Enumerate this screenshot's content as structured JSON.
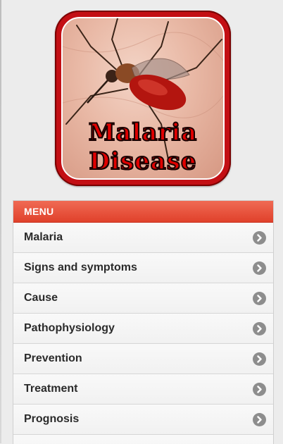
{
  "logo": {
    "line1": "Malaria",
    "line2": "Disease",
    "image_icon": "mosquito-icon",
    "frame_color": "#c30f14"
  },
  "menu": {
    "header": "MENU",
    "header_color": "#e94b35",
    "items": [
      {
        "label": "Malaria"
      },
      {
        "label": "Signs and symptoms"
      },
      {
        "label": "Cause"
      },
      {
        "label": "Pathophysiology"
      },
      {
        "label": "Prevention"
      },
      {
        "label": "Treatment"
      },
      {
        "label": "Prognosis"
      },
      {
        "label": ""
      }
    ],
    "item_icon": "chevron-right-icon"
  }
}
